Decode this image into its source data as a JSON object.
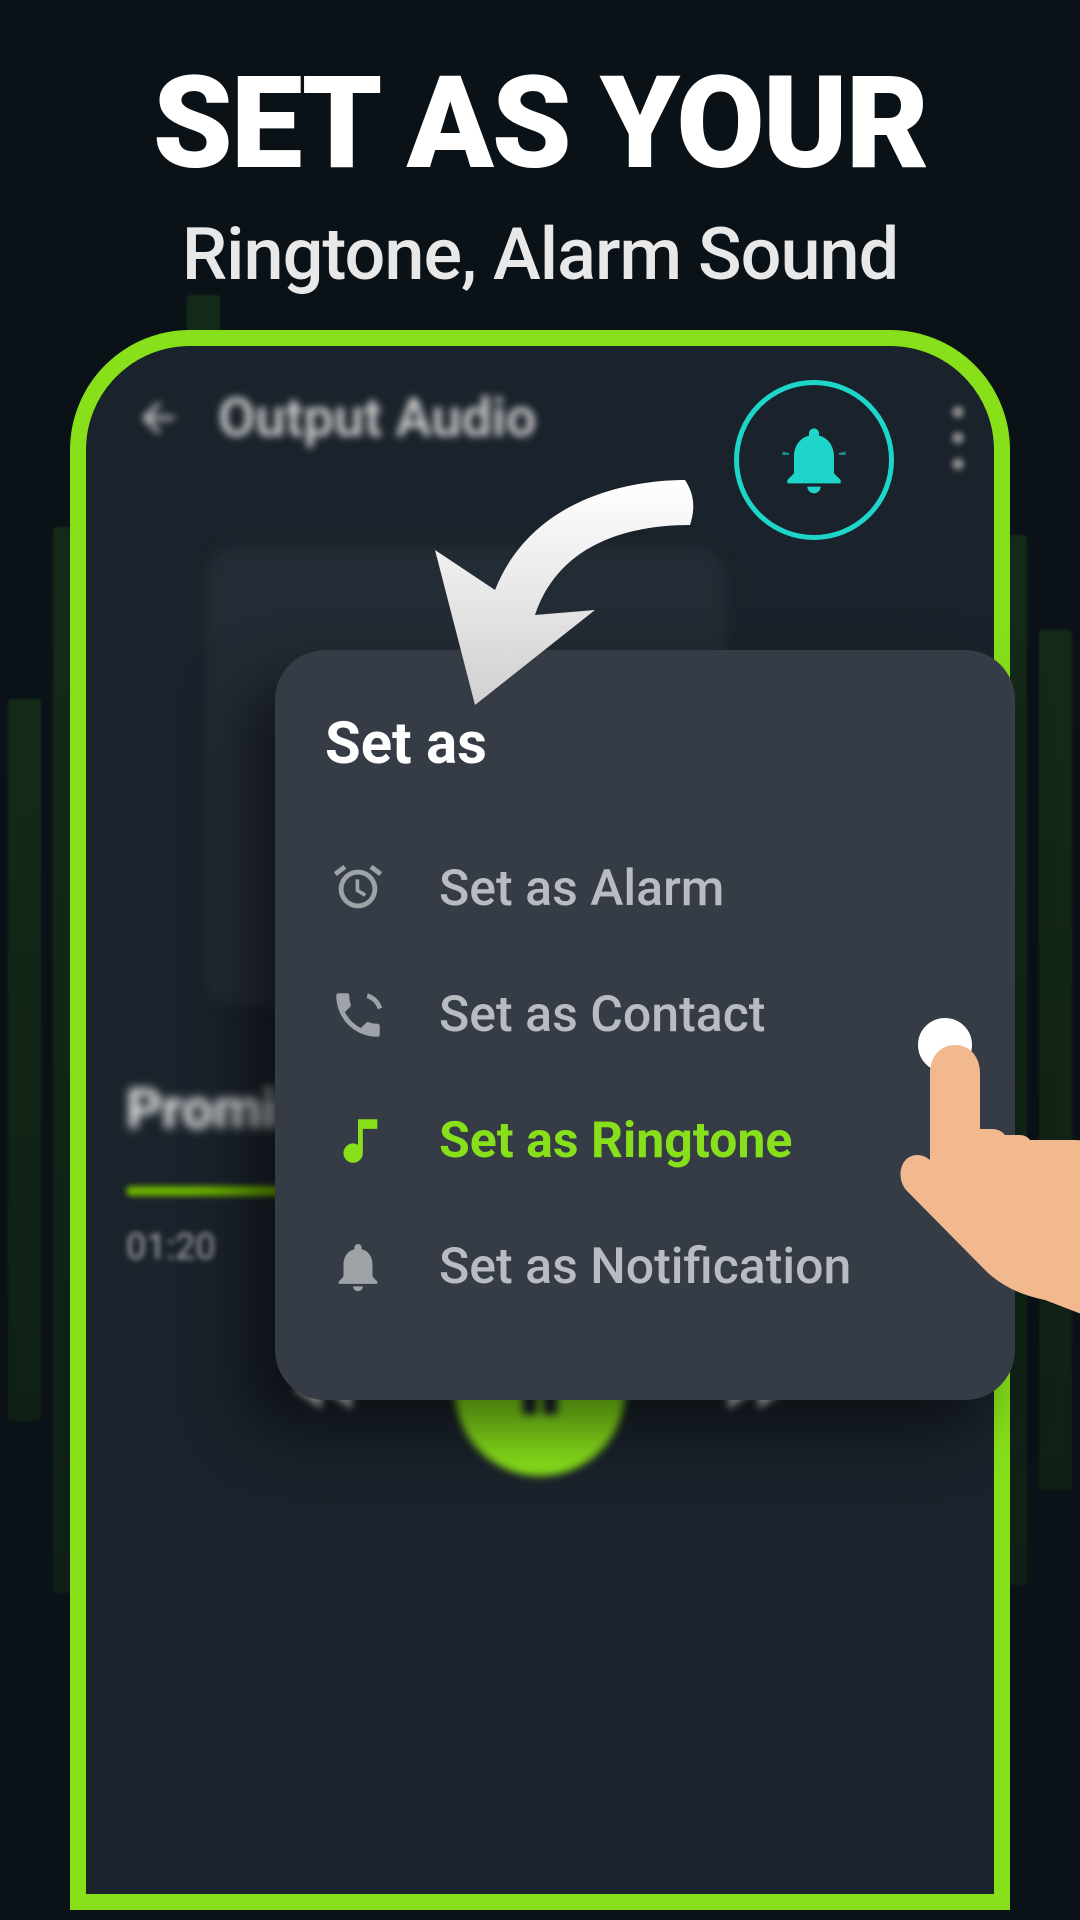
{
  "hero": {
    "line1": "SET AS YOUR",
    "line2": "Ringtone, Alarm Sound"
  },
  "phone": {
    "header_title": "Output Audio",
    "track_title": "Promise",
    "time_label": "01:20"
  },
  "popup": {
    "title": "Set as",
    "items": [
      {
        "label": "Set as Alarm",
        "icon": "alarm-icon",
        "active": false
      },
      {
        "label": "Set as Contact",
        "icon": "phone-icon",
        "active": false
      },
      {
        "label": "Set as Ringtone",
        "icon": "music-icon",
        "active": true
      },
      {
        "label": "Set as Notification",
        "icon": "bell-icon",
        "active": false
      }
    ]
  },
  "colors": {
    "accent_green": "#87e01a",
    "accent_cyan": "#1dd6c9",
    "popup_bg": "#353c46",
    "phone_bg": "#1a222b"
  }
}
